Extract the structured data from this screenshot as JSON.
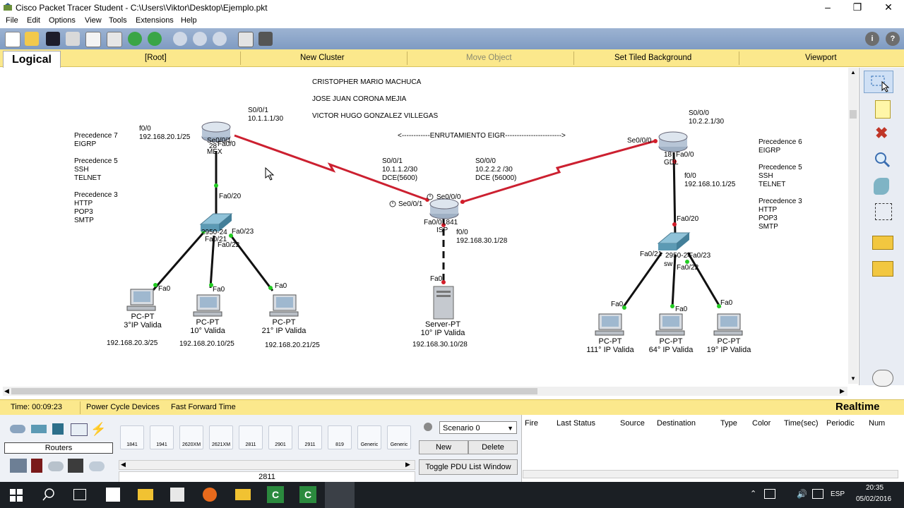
{
  "window": {
    "title": "Cisco Packet Tracer Student - C:\\Users\\Viktor\\Desktop\\Ejemplo.pkt"
  },
  "menu": [
    "File",
    "Edit",
    "Options",
    "View",
    "Tools",
    "Extensions",
    "Help"
  ],
  "navbar": {
    "logical": "Logical",
    "root": "[Root]",
    "new_cluster": "New Cluster",
    "move_object": "Move Object",
    "set_tiled_background": "Set Tiled Background",
    "viewport": "Viewport"
  },
  "names": [
    "CRISTOPHER MARIO MACHUCA",
    "JOSE JUAN CORONA MEJIA",
    "VICTOR HUGO GONZALEZ VILLEGAS"
  ],
  "routing_note": "<------------ENRUTAMIENTO EIGR------------------------>",
  "left_precedence": [
    "Precedence 7",
    "EIGRP",
    "",
    "Precedence 5",
    "SSH",
    "TELNET",
    "",
    "Precedence 3",
    "HTTP",
    "POP3",
    "SMTP"
  ],
  "right_precedence": [
    "Precedence 6",
    "EIGRP",
    "",
    "Precedence 5",
    "SSH",
    "TELNET",
    "",
    "Precedence 3",
    "HTTP",
    "POP3",
    "SMTP"
  ],
  "labels": {
    "mex_f00": "f0/0",
    "mex_f00_ip": "192.168.20.1/25",
    "mex_s001": "S0/0/1",
    "mex_s001_ip": "10.1.1.1/30",
    "mex_name_a": "28",
    "mex_name_b": "MEX",
    "mex_if_se": "Se0/0/1",
    "mex_if_fa": "Fa0/0",
    "sw1_fa020": "Fa0/20",
    "sw1_model": "2950-24",
    "sw1_fa023": "Fa0/23",
    "sw1_fa021": "Fa0/21",
    "sw1_fa022": "Fa0/22",
    "isp_s001": "S0/0/1",
    "isp_s001_ip": "10.1.1.2/30",
    "isp_s001_dce": "DCE(5600)",
    "isp_s000": "S0/0/0",
    "isp_s000_ip": "10.2.2.2 /30",
    "isp_s000_dce": "DCE (56000)",
    "isp_if_se000": "Se0/0/0",
    "isp_if_se001": "Se0/0/1",
    "isp_if_fa00": "Fa0/0",
    "isp_model": "1841",
    "isp_name": "ISP",
    "isp_f00": "f0/0",
    "isp_f00_ip": "192.168.30.1/28",
    "gdl_s000": "S0/0/0",
    "gdl_s000_ip": "10.2.2.1/30",
    "gdl_if_se": "Se0/0/0",
    "gdl_model": "18",
    "gdl_if_fa": "Fa0/0",
    "gdl_name": "GDL",
    "gdl_f00": "f0/0",
    "gdl_f00_ip": "192.168.10.1/25",
    "sw2_fa020": "Fa0/20",
    "sw2_fa021": "Fa0/21",
    "sw2_model": "2950-24",
    "sw2_fa023": "Fa0/23",
    "sw2_name": "sw",
    "sw2_fa022": "Fa0/22",
    "server_fa0": "Fa0"
  },
  "pcs_left": [
    {
      "type": "PC-PT",
      "name": "3°IP Valida",
      "ip": "192.168.20.3/25",
      "fa": "Fa0"
    },
    {
      "type": "PC-PT",
      "name": "10° Valida",
      "ip": "192.168.20.10/25",
      "fa": "Fa0"
    },
    {
      "type": "PC-PT",
      "name": "21° IP Valida",
      "ip": "192.168.20.21/25",
      "fa": "Fa0"
    }
  ],
  "server": {
    "type": "Server-PT",
    "name": "10° IP Valida",
    "ip": "192.168.30.10/28"
  },
  "pcs_right": [
    {
      "type": "PC-PT",
      "name": "111° IP Valida",
      "fa": "Fa0"
    },
    {
      "type": "PC-PT",
      "name": "64° IP Valida",
      "fa": "Fa0"
    },
    {
      "type": "PC-PT",
      "name": "19° IP Valida",
      "fa": "Fa0"
    }
  ],
  "status": {
    "time": "Time: 00:09:23",
    "power_cycle": "Power Cycle Devices",
    "fast_forward": "Fast Forward Time",
    "mode": "Realtime"
  },
  "device_panel": {
    "category": "Routers",
    "selected": "2811",
    "models": [
      "1841",
      "1941",
      "2620XM",
      "2621XM",
      "2811",
      "2901",
      "2911",
      "819",
      "Generic",
      "Generic"
    ]
  },
  "scenario": {
    "selected": "Scenario 0",
    "new": "New",
    "delete": "Delete",
    "toggle": "Toggle PDU List Window"
  },
  "pdu_columns": [
    "Fire",
    "Last Status",
    "Source",
    "Destination",
    "Type",
    "Color",
    "Time(sec)",
    "Periodic",
    "Num"
  ],
  "taskbar": {
    "lang": "ESP",
    "time": "20:35",
    "date": "05/02/2016"
  },
  "colors": {
    "serial": "#cc2030",
    "ethernet": "#111111",
    "navbar": "#fbe88c",
    "toolbar": "#8aa5cb",
    "link_up": "#22cc22",
    "link_down": "#d21e2a"
  }
}
